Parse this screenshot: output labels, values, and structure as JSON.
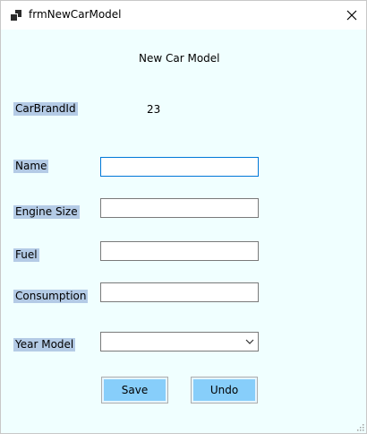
{
  "window": {
    "title": "frmNewCarModel",
    "background": "#f0ffff"
  },
  "form": {
    "title": "New Car Model",
    "car_brand_id": {
      "label": "CarBrandId",
      "value": "23"
    },
    "name": {
      "label": "Name",
      "value": ""
    },
    "engine_size": {
      "label": "Engine Size",
      "value": ""
    },
    "fuel": {
      "label": "Fuel",
      "value": ""
    },
    "consumption": {
      "label": "Consumption",
      "value": ""
    },
    "year_model": {
      "label": "Year Model",
      "selected": ""
    },
    "label_highlight_color": "#b4cbe6"
  },
  "buttons": {
    "save_label": "Save",
    "undo_label": "Undo",
    "color": "#87cefa"
  },
  "icons": {
    "app": "app-window-icon",
    "close": "close-icon",
    "combo": "chevron-down-icon",
    "resize": "resize-grip-icon"
  }
}
